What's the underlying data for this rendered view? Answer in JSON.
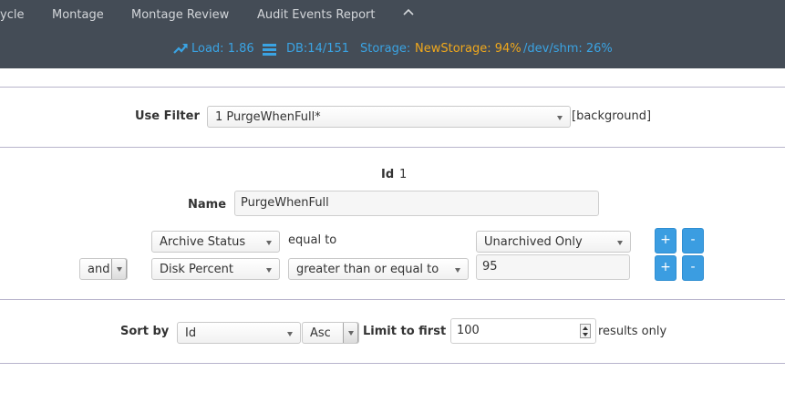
{
  "nav": {
    "items": [
      "ycle",
      "Montage",
      "Montage Review",
      "Audit Events Report"
    ],
    "collapse_icon": "chevron-up-icon"
  },
  "status": {
    "load": "Load: 1.86",
    "db": "DB:14/151",
    "storage_label": "Storage:",
    "storage_new": "NewStorage: 94%",
    "storage_shm": "/dev/shm: 26%",
    "accent_color": "#3aa3e3",
    "warning_color": "#f0a81c",
    "load_icon": "trend-up-icon",
    "db_icon": "database-icon"
  },
  "filter": {
    "label": "Use Filter",
    "selected": "1 PurgeWhenFull*",
    "background_note": "[background]"
  },
  "form": {
    "id_label": "Id",
    "id_value": "1",
    "name_label": "Name",
    "name_value": "PurgeWhenFull"
  },
  "terms": [
    {
      "conjunction": "",
      "attribute": "Archive Status",
      "operator": "equal to",
      "value": "Unarchived Only",
      "add_label": "+",
      "remove_label": "-"
    },
    {
      "conjunction": "and",
      "attribute": "Disk Percent",
      "operator": "greater than or equal to",
      "value": "95",
      "add_label": "+",
      "remove_label": "-"
    }
  ],
  "sort": {
    "label": "Sort by",
    "field": "Id",
    "direction": "Asc",
    "limit_label": "Limit to first",
    "limit_value": "100",
    "results_suffix": "results only"
  }
}
